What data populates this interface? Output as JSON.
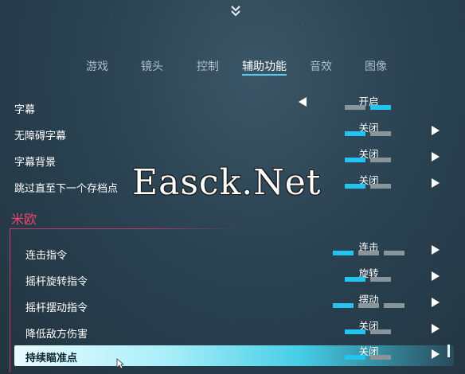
{
  "tabs": [
    {
      "label": "游戏"
    },
    {
      "label": "镜头"
    },
    {
      "label": "控制"
    },
    {
      "label": "辅助功能",
      "active": true
    },
    {
      "label": "音效"
    },
    {
      "label": "图像"
    }
  ],
  "settings": [
    {
      "label": "字幕",
      "value": "开启",
      "bars_on": [
        false,
        true
      ]
    },
    {
      "label": "无障碍字幕",
      "value": "关闭",
      "bars_on": [
        true,
        false
      ]
    },
    {
      "label": "字幕背景",
      "value": "关闭",
      "bars_on": [
        true,
        false
      ]
    },
    {
      "label": "跳过直至下一个存档点",
      "value": "关闭",
      "bars_on": [
        true,
        false
      ]
    }
  ],
  "section": {
    "title": "米欧"
  },
  "section_settings": [
    {
      "label": "连击指令",
      "value": "连击",
      "bars_on": [
        true,
        false,
        false
      ]
    },
    {
      "label": "摇杆旋转指令",
      "value": "旋转",
      "bars_on": [
        true,
        false
      ]
    },
    {
      "label": "摇杆摆动指令",
      "value": "摆动",
      "bars_on": [
        true,
        false,
        false
      ]
    },
    {
      "label": "降低敌方伤害",
      "value": "关闭",
      "bars_on": [
        true,
        false
      ]
    },
    {
      "label": "持续瞄准点",
      "value": "关闭",
      "bars_on": [
        true,
        false
      ]
    }
  ],
  "watermark": "Easck.Net",
  "colors": {
    "accent": "#22c4f0",
    "section": "#f0436f",
    "bar_off": "#8a959b"
  },
  "icons": {
    "top": "double-chevron-down-icon",
    "right": "triangle-right-icon",
    "left": "triangle-left-icon"
  }
}
